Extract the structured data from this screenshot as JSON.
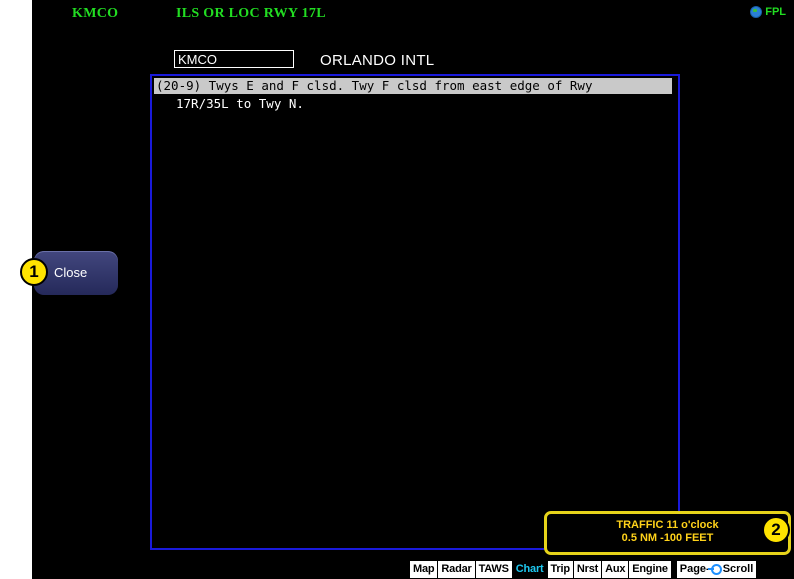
{
  "header": {
    "airport": "KMCO",
    "procedure": "ILS OR LOC RWY 17L",
    "mode": "FPL"
  },
  "airport_entry": {
    "identifier": "KMCO",
    "name": "ORLANDO INTL"
  },
  "notam": {
    "line1": "(20-9) Twys E and F clsd. Twy F clsd from east edge of Rwy",
    "line2": "17R/35L to Twy N."
  },
  "close_button": {
    "label": "Close"
  },
  "callouts": [
    "1",
    "2"
  ],
  "traffic": {
    "line1": "TRAFFIC 11 o'clock",
    "line2": "0.5 NM  -100 FEET"
  },
  "softkeys": {
    "tabs": [
      "Map",
      "Radar",
      "TAWS",
      "Chart",
      "Trip",
      "Nrst",
      "Aux",
      "Engine"
    ],
    "active": "Chart",
    "page_label": "Page-",
    "scroll_label": "Scroll"
  },
  "colors": {
    "header_text": "#22dd22",
    "panel_border": "#1a1adb",
    "highlight_row": "#c9c9c9",
    "traffic_border": "#e6d31a",
    "traffic_text": "#ffd21a",
    "active_tab_text": "#1ec8f0",
    "callout_fill": "#ffe300"
  },
  "icons": {
    "mode": "globe-icon",
    "knob": "knob-icon"
  }
}
